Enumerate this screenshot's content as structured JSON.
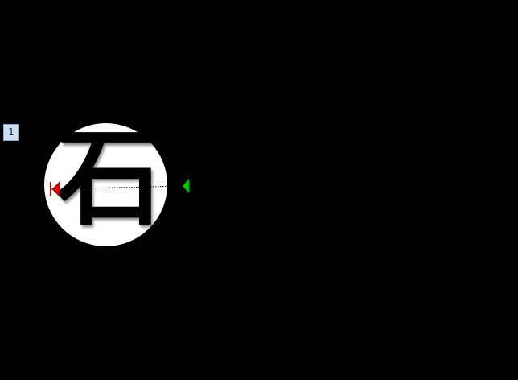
{
  "slide": {
    "number_label": "1"
  },
  "shape": {
    "character": "石",
    "fill_color": "#ffffff",
    "text_color": "#000000"
  },
  "motion_path": {
    "start_marker_color": "#e00000",
    "end_marker_color": "#00cc00",
    "path_color": "#000000"
  }
}
